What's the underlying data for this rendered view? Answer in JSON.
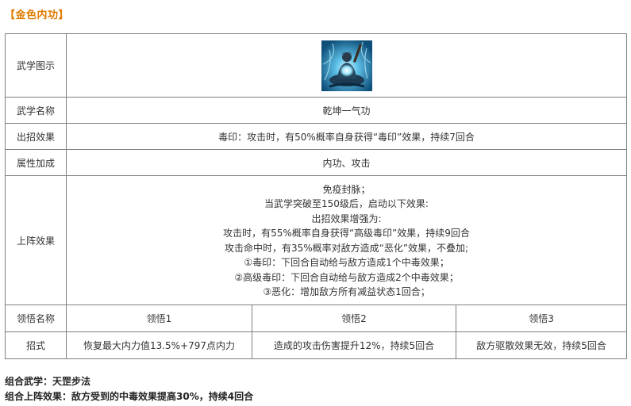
{
  "section_title": "【金色内功】",
  "rows": {
    "icon_label": "武学图示",
    "name_label": "武学名称",
    "name_value": "乾坤一气功",
    "effect_label": "出招效果",
    "effect_value": "毒印：攻击时，有50%概率自身获得“毒印”效果，持续7回合",
    "attr_label": "属性加成",
    "attr_value": "内功、攻击",
    "deploy_label": "上阵效果",
    "deploy_lines": [
      "免疫封脉；",
      "当武学突破至150级后，启动以下效果:",
      "出招效果增强为:",
      "攻击时，有55%概率自身获得“高级毒印”效果，持续9回合",
      "攻击命中时，有35%概率对敌方造成“恶化”效果，不叠加;",
      "①毒印：下回合自动给与敌方造成1个中毒效果；",
      "②高级毒印：下回合自动给与敌方造成2个中毒效果；",
      "③恶化：增加敌方所有减益状态1回合；"
    ],
    "insight_label": "领悟名称",
    "insights": [
      "领悟1",
      "领悟2",
      "领悟3"
    ],
    "move_label": "招式",
    "moves": [
      "恢复最大内力值13.5%+797点内力",
      "造成的攻击伤害提升12%，持续5回合",
      "敌方驱散效果无效，持续5回合"
    ]
  },
  "footer": {
    "combo_skill": "组合武学：天罡步法",
    "combo_effect": "组合上阵效果：敌方受到的中毒效果提高30%，持续4回合"
  },
  "colors": {
    "title": "#e07b00",
    "border": "#808080"
  },
  "icon": "meditating-martial-artist-portrait"
}
